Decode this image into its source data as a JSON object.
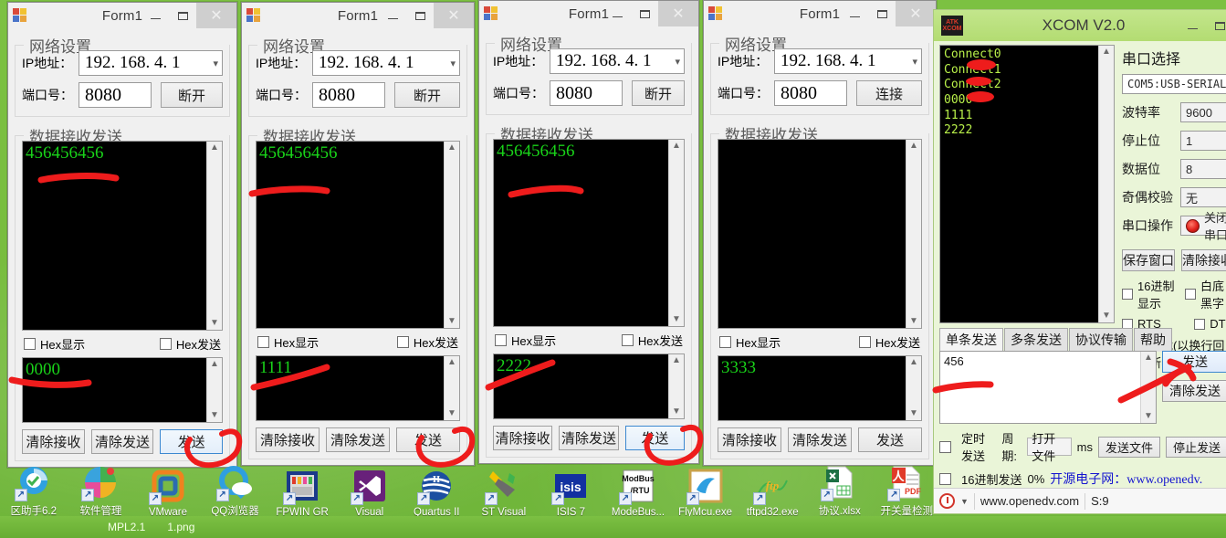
{
  "desktop": {
    "taskbar_items": [
      "MPL2.1",
      "1.png"
    ],
    "icons": [
      {
        "name": "qu-zhushou",
        "label": "区助手6.2",
        "glyph": "shield",
        "colors": [
          "#2fa1e0",
          "#e03b2a",
          "#3fb34f"
        ]
      },
      {
        "name": "ruanjian-guanli",
        "label": "软件管理",
        "glyph": "pinwheel",
        "colors": [
          "#39a3dd",
          "#e8403d",
          "#f0b323",
          "#44b14f"
        ]
      },
      {
        "name": "vmware",
        "label": "VMware",
        "glyph": "vmware",
        "colors": [
          "#f0821e",
          "#2b6cb0"
        ]
      },
      {
        "name": "qq-browser",
        "label": "QQ浏览器",
        "glyph": "qq",
        "colors": [
          "#2f9fe0",
          "#ffffff"
        ]
      },
      {
        "name": "fpwin-gr",
        "label": "FPWIN GR",
        "glyph": "fpwin",
        "colors": [
          "#1b3a8a",
          "#dcdcdc"
        ]
      },
      {
        "name": "visual-studio",
        "label": "Visual",
        "glyph": "vs",
        "colors": [
          "#68217a",
          "#ffffff"
        ]
      },
      {
        "name": "quartus-ii",
        "label": "Quartus II",
        "glyph": "quartus",
        "colors": [
          "#1c4fa1",
          "#ffffff"
        ]
      },
      {
        "name": "st-visual",
        "label": "ST Visual",
        "glyph": "stvd",
        "colors": [
          "#f2c300",
          "#6b6b6b"
        ]
      },
      {
        "name": "isis-7",
        "label": "ISIS 7",
        "glyph": "isis",
        "colors": [
          "#1230a0",
          "#ffffff"
        ]
      },
      {
        "name": "modebus-rtu",
        "label": "ModeBus...",
        "glyph": "modbus",
        "colors": [
          "#ffffff",
          "#111111"
        ]
      },
      {
        "name": "flymcu-exe",
        "label": "FlyMcu.exe",
        "glyph": "flymcu",
        "colors": [
          "#2f9fe0",
          "#c8a24a"
        ]
      },
      {
        "name": "tftpd32-exe",
        "label": "tftpd32.exe",
        "glyph": "tftp",
        "colors": [
          "#3fb34f",
          "#f0b323"
        ]
      },
      {
        "name": "xieyi-xlsx",
        "label": "协议.xlsx",
        "glyph": "excel",
        "colors": [
          "#1d7044",
          "#ffffff"
        ]
      },
      {
        "name": "kaiguanliang-jiance",
        "label": "开关量检测",
        "glyph": "pdf",
        "colors": [
          "#e03b2a",
          "#ffffff"
        ]
      }
    ]
  },
  "forms": [
    {
      "title": "Form1",
      "net_group_title": "网络设置",
      "ip_label": "IP地址：",
      "ip_value": "192. 168. 4. 1",
      "port_label": "端口号：",
      "port_value": "8080",
      "conn_button": "断开",
      "data_group_title": "数据接收发送",
      "recv_text": "456456456",
      "hex_display_label": "Hex显示",
      "hex_send_label": "Hex发送",
      "send_text": "0000",
      "clear_recv_button": "清除接收",
      "clear_send_button": "清除发送",
      "send_button": "发送",
      "send_button_focused": true
    },
    {
      "title": "Form1",
      "net_group_title": "网络设置",
      "ip_label": "IP地址：",
      "ip_value": "192. 168. 4. 1",
      "port_label": "端口号：",
      "port_value": "8080",
      "conn_button": "断开",
      "data_group_title": "数据接收发送",
      "recv_text": "456456456",
      "hex_display_label": "Hex显示",
      "hex_send_label": "Hex发送",
      "send_text": "1111",
      "clear_recv_button": "清除接收",
      "clear_send_button": "清除发送",
      "send_button": "发送",
      "send_button_focused": false
    },
    {
      "title": "Form1",
      "net_group_title": "网络设置",
      "ip_label": "IP地址：",
      "ip_value": "192. 168. 4. 1",
      "port_label": "端口号：",
      "port_value": "8080",
      "conn_button": "断开",
      "data_group_title": "数据接收发送",
      "recv_text": "456456456",
      "hex_display_label": "Hex显示",
      "hex_send_label": "Hex发送",
      "send_text": "2222",
      "clear_recv_button": "清除接收",
      "clear_send_button": "清除发送",
      "send_button": "发送",
      "send_button_focused": true
    },
    {
      "title": "Form1",
      "net_group_title": "网络设置",
      "ip_label": "IP地址：",
      "ip_value": "192. 168. 4. 1",
      "port_label": "端口号：",
      "port_value": "8080",
      "conn_button": "连接",
      "data_group_title": "数据接收发送",
      "recv_text": "",
      "hex_display_label": "Hex显示",
      "hex_send_label": "Hex发送",
      "send_text": "3333",
      "clear_recv_button": "清除接收",
      "clear_send_button": "清除发送",
      "send_button": "发送",
      "send_button_focused": false
    }
  ],
  "xcom": {
    "title": "XCOM V2.0",
    "logo_top": "ATK",
    "logo_bottom": "XCOM",
    "console_text": "Connect0\nConnect1\nConnect2\n0000\n1111\n2222",
    "port_section_title": "串口选择",
    "port_value": "COM5:USB-SERIAL",
    "baud_label": "波特率",
    "baud_value": "9600",
    "stopbits_label": "停止位",
    "stopbits_value": "1",
    "databits_label": "数据位",
    "databits_value": "8",
    "parity_label": "奇偶校验",
    "parity_value": "无",
    "port_op_label": "串口操作",
    "port_op_value": "关闭串口",
    "save_window_button": "保存窗口",
    "clear_recv_button": "清除接收",
    "hex_display_label": "16进制显示",
    "auto_newline_label": "白底黑字",
    "rts_label": "RTS",
    "dtr_label": "DTR",
    "timestamp_label": "时间戳(以换行回车断帧)",
    "tabs": [
      {
        "label": "单条发送",
        "active": true
      },
      {
        "label": "多条发送",
        "active": false
      },
      {
        "label": "协议传输",
        "active": false
      },
      {
        "label": "帮助",
        "active": false
      }
    ],
    "send_text": "456",
    "send_button": "发送",
    "clear_send_button": "清除发送",
    "timed_send_label": "定时发送",
    "period_label": "周期:",
    "open_file_label": "打开文件",
    "ms_label": "ms",
    "send_file_button": "发送文件",
    "stop_send_button": "停止发送",
    "hex_send_label": "16进制发送",
    "progress_label": "0%",
    "promo_text": "开源电子网：www.openedv.",
    "status_url": "www.openedv.com",
    "status_counter": "S:9"
  },
  "colors": {
    "desktop_green": "#7dc242",
    "annotation_red": "#ee1c1c",
    "console_green": "#19d219",
    "xcom_console_green": "#b9f04a",
    "accent_blue": "#3c88d0"
  }
}
